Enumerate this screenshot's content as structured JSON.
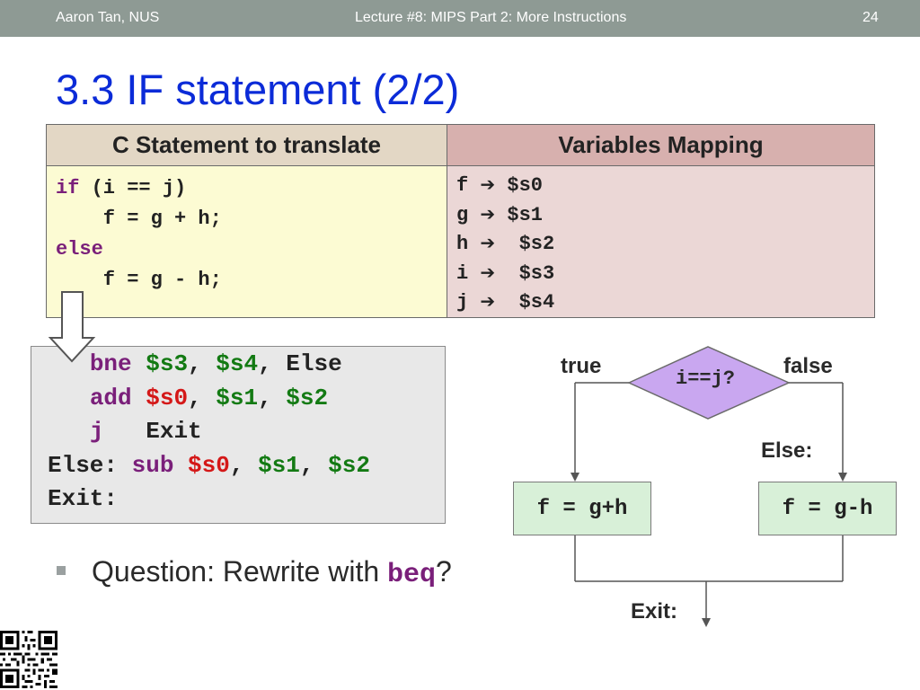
{
  "header": {
    "author": "Aaron Tan, NUS",
    "lecture": "Lecture #8: MIPS Part 2: More Instructions",
    "page": "24"
  },
  "title": "3.3 IF statement (2/2)",
  "table": {
    "col1_header": "C Statement to translate",
    "col2_header": "Variables Mapping",
    "c_code": {
      "line1_kw": "if",
      "line1_rest": " (i == j)",
      "line2": "    f = g + h;",
      "line3_kw": "else",
      "line4": "    f = g - h;"
    },
    "mapping": [
      {
        "var": "f",
        "reg": "$s0"
      },
      {
        "var": "g",
        "reg": "$s1"
      },
      {
        "var": "h",
        "reg": "$s2"
      },
      {
        "var": "i",
        "reg": "$s3"
      },
      {
        "var": "j",
        "reg": "$s4"
      }
    ]
  },
  "assembly": {
    "l1": {
      "indent": "   ",
      "op": "bne",
      "r1": "$s3",
      "sep1": ", ",
      "r2": "$s4",
      "sep2": ", ",
      "target": "Else"
    },
    "l2": {
      "indent": "   ",
      "op": "add",
      "r1": "$s0",
      "sep1": ", ",
      "r2": "$s1",
      "sep2": ", ",
      "r3": "$s2"
    },
    "l3": {
      "indent": "   ",
      "op": "j",
      "target": "Exit"
    },
    "l4": {
      "label": "Else:",
      "op": "sub",
      "r1": "$s0",
      "sep1": ", ",
      "r2": "$s1",
      "sep2": ", ",
      "r3": "$s2"
    },
    "l5": {
      "label": "Exit:"
    }
  },
  "question": {
    "text": "Question: Rewrite with ",
    "keyword": "beq",
    "suffix": "?"
  },
  "flowchart": {
    "condition": "i==j?",
    "true_label": "true",
    "false_label": "false",
    "true_box": "f = g+h",
    "false_box": "f = g-h",
    "else_label": "Else:",
    "exit_label": "Exit:"
  },
  "colors": {
    "title": "#0b2bd8",
    "keyword": "#7a1f7a",
    "register": "#137a13",
    "register_dest": "#d41818",
    "diamond": "#c9a7f0",
    "box": "#d8f0d8"
  },
  "icons": {
    "mapping_arrow": "right-arrow-icon",
    "down_arrow": "hollow-down-arrow-icon",
    "qr": "qr-code-icon"
  }
}
